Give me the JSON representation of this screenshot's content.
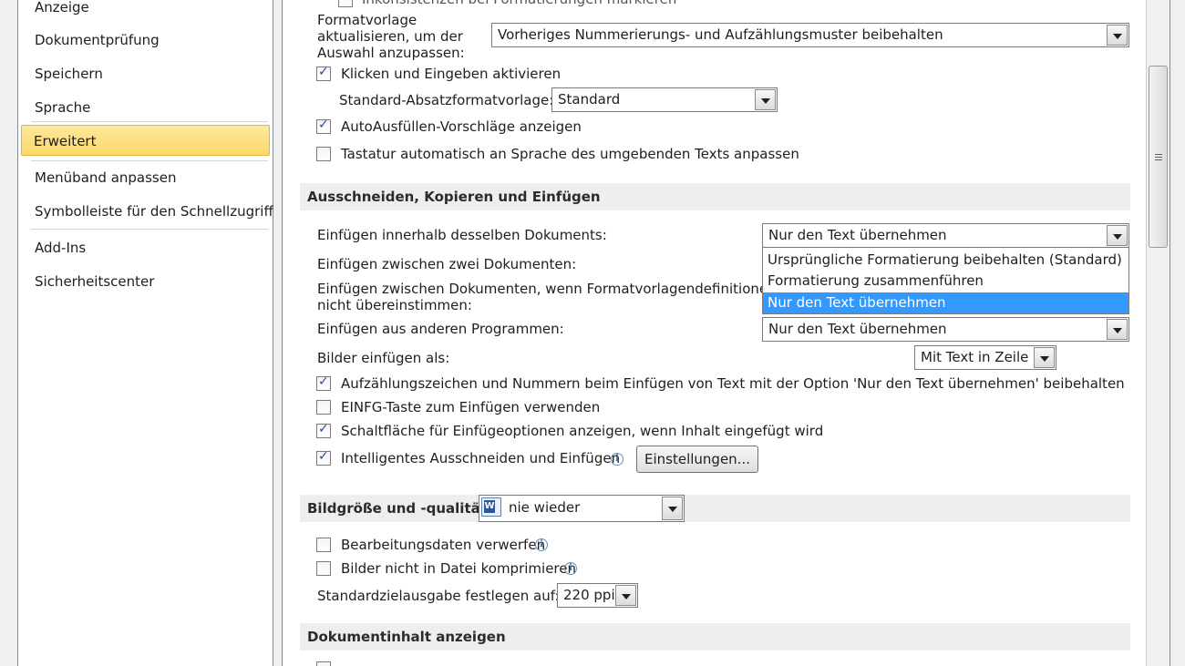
{
  "sidebar": {
    "items": [
      {
        "label": "Anzeige"
      },
      {
        "label": "Dokumentprüfung"
      },
      {
        "label": "Speichern"
      },
      {
        "label": "Sprache"
      },
      {
        "label": "Erweitert"
      },
      {
        "label": "Menüband anpassen"
      },
      {
        "label": "Symbolleiste für den Schnellzugriff"
      },
      {
        "label": "Add-Ins"
      },
      {
        "label": "Sicherheitscenter"
      }
    ]
  },
  "editing": {
    "partial_top_label": "Inkonsistenzen bei Formatierungen markieren",
    "style_update_label": [
      "Formatvorlage",
      "aktualisieren, um der",
      "Auswahl anzupassen:"
    ],
    "style_update_value": "Vorheriges Nummerierungs- und Aufzählungsmuster beibehalten",
    "click_type_label": "Klicken und Eingeben aktivieren",
    "default_para_label": "Standard-Absatzformatvorlage:",
    "default_para_value": "Standard",
    "autocomplete_label": "AutoAusfüllen-Vorschläge anzeigen",
    "keyboard_label": "Tastatur automatisch an Sprache des umgebenden Texts anpassen"
  },
  "cutcopy": {
    "section_title": "Ausschneiden, Kopieren und Einfügen",
    "within_doc_label": "Einfügen innerhalb desselben Dokuments:",
    "within_doc_value": "Nur den Text übernehmen",
    "dropdown_options": [
      "Ursprüngliche Formatierung beibehalten (Standard)",
      "Formatierung zusammenführen",
      "Nur den Text übernehmen"
    ],
    "between_docs_label": "Einfügen zwischen zwei Dokumenten:",
    "between_conflict_label": [
      "Einfügen zwischen Dokumenten, wenn Formatvorlagendefinitionen",
      "nicht übereinstimmen:"
    ],
    "other_programs_label": "Einfügen aus anderen Programmen:",
    "other_programs_value": "Nur den Text übernehmen",
    "pictures_label": "Bilder einfügen als:",
    "pictures_value": "Mit Text in Zeile",
    "keep_bullets_label": "Aufzählungszeichen und Nummern beim Einfügen von Text mit der Option 'Nur den Text übernehmen' beibehalten",
    "insert_key_label": "EINFG-Taste zum Einfügen verwenden",
    "paste_options_label": "Schaltfläche für Einfügeoptionen anzeigen, wenn Inhalt eingefügt wird",
    "smart_cut_label": "Intelligentes Ausschneiden und Einfügen",
    "settings_button": "Einstellungen..."
  },
  "image": {
    "section_title": "Bildgröße und -qualität",
    "doc_value": "nie wieder",
    "discard_label": "Bearbeitungsdaten verwerfen",
    "no_compress_label": "Bilder nicht in Datei komprimieren",
    "target_label": "Standardzielausgabe festlegen auf:",
    "target_value": "220 ppi"
  },
  "content": {
    "section_title": "Dokumentinhalt anzeigen"
  },
  "checkbox_mark": "✓",
  "info_symbol": "i",
  "word_glyph": "W"
}
